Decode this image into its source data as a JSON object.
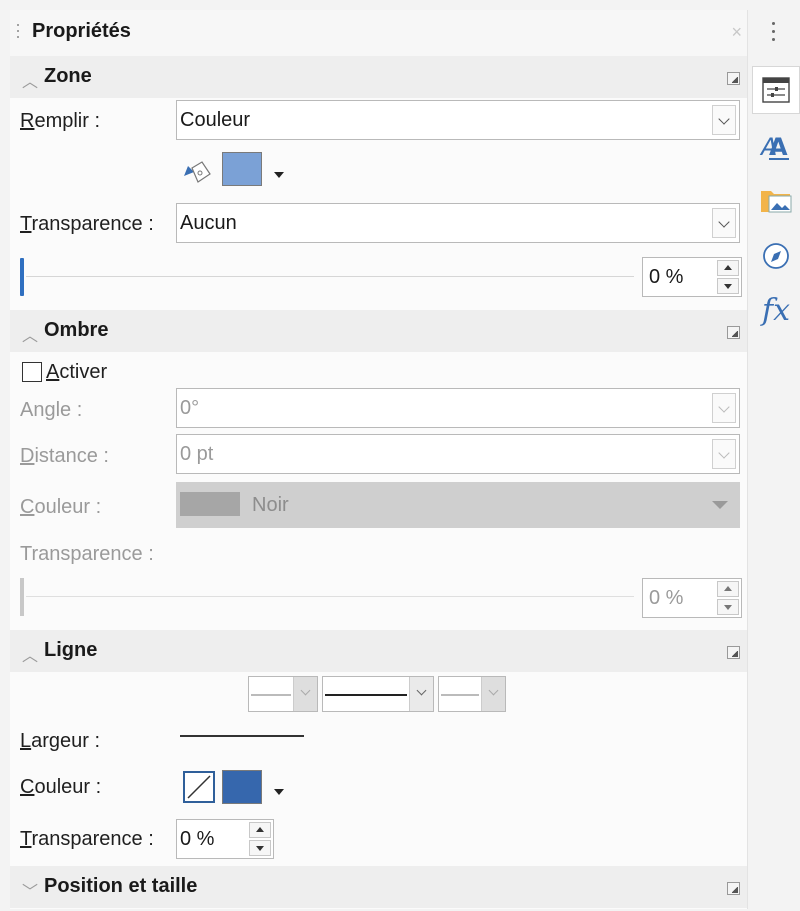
{
  "panel": {
    "title": "Propriétés",
    "close_glyph": "×"
  },
  "zone": {
    "title": "Zone",
    "fill_label_u": "R",
    "fill_label_rest": "emplir :",
    "fill_value": "Couleur",
    "fill_color": "#7ba1d6",
    "transparency_label_u": "T",
    "transparency_label_rest": "ransparence :",
    "transparency_value": "Aucun",
    "slider_value": "0 %"
  },
  "ombre": {
    "title": "Ombre",
    "activate_label_u": "A",
    "activate_label_rest": "ctiver",
    "activate_checked": false,
    "angle_label_a": "An",
    "angle_label_u": "g",
    "angle_label_b": "le :",
    "angle_value": "0°",
    "distance_label_u": "D",
    "distance_label_rest": "istance :",
    "distance_value": "0 pt",
    "color_label_u": "C",
    "color_label_rest": "ouleur :",
    "color_value": "Noir",
    "color_swatch": "#a6a6a6",
    "transparency_label": "Transparence :",
    "slider_value": "0 %"
  },
  "ligne": {
    "title": "Ligne",
    "width_label_u": "L",
    "width_label_rest": "argeur :",
    "color_label_u": "C",
    "color_label_rest": "ouleur :",
    "line_color": "#3667ad",
    "transparency_label_u": "T",
    "transparency_label_rest": "ransparence :",
    "transparency_value": "0 %"
  },
  "position": {
    "title": "Position et taille"
  },
  "sidebar": {
    "icons": [
      "properties-icon",
      "styles-icon",
      "gallery-icon",
      "navigator-icon",
      "functions-icon"
    ],
    "functions_label": "fx"
  }
}
